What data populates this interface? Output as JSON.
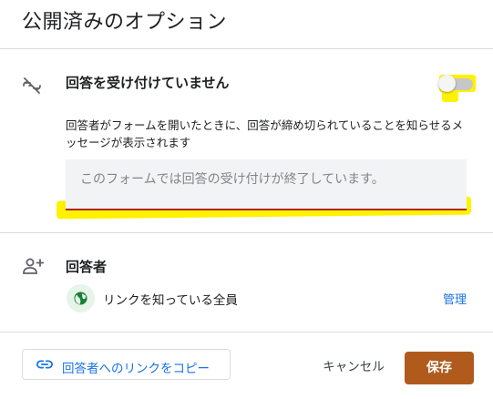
{
  "dialog": {
    "title": "公開済みのオプション"
  },
  "responses": {
    "heading": "回答を受け付けていません",
    "toggle_on": false,
    "description": "回答者がフォームを開いたときに、回答が締め切られていることを知らせるメッセージが表示されます",
    "message_placeholder": "このフォームでは回答の受け付けが終了しています。",
    "message_value": "",
    "highlight_color": "#fff200",
    "underline_color": "#b3261e"
  },
  "respondents": {
    "heading": "回答者",
    "access_label": "リンクを知っている全員",
    "manage_label": "管理"
  },
  "footer": {
    "copy_link_label": "回答者へのリンクをコピー",
    "cancel_label": "キャンセル",
    "save_label": "保存",
    "save_color": "#b05b1d",
    "link_color": "#1a73e8"
  },
  "icons": [
    "link-off-icon",
    "add-person-icon",
    "globe-icon",
    "link-icon"
  ]
}
